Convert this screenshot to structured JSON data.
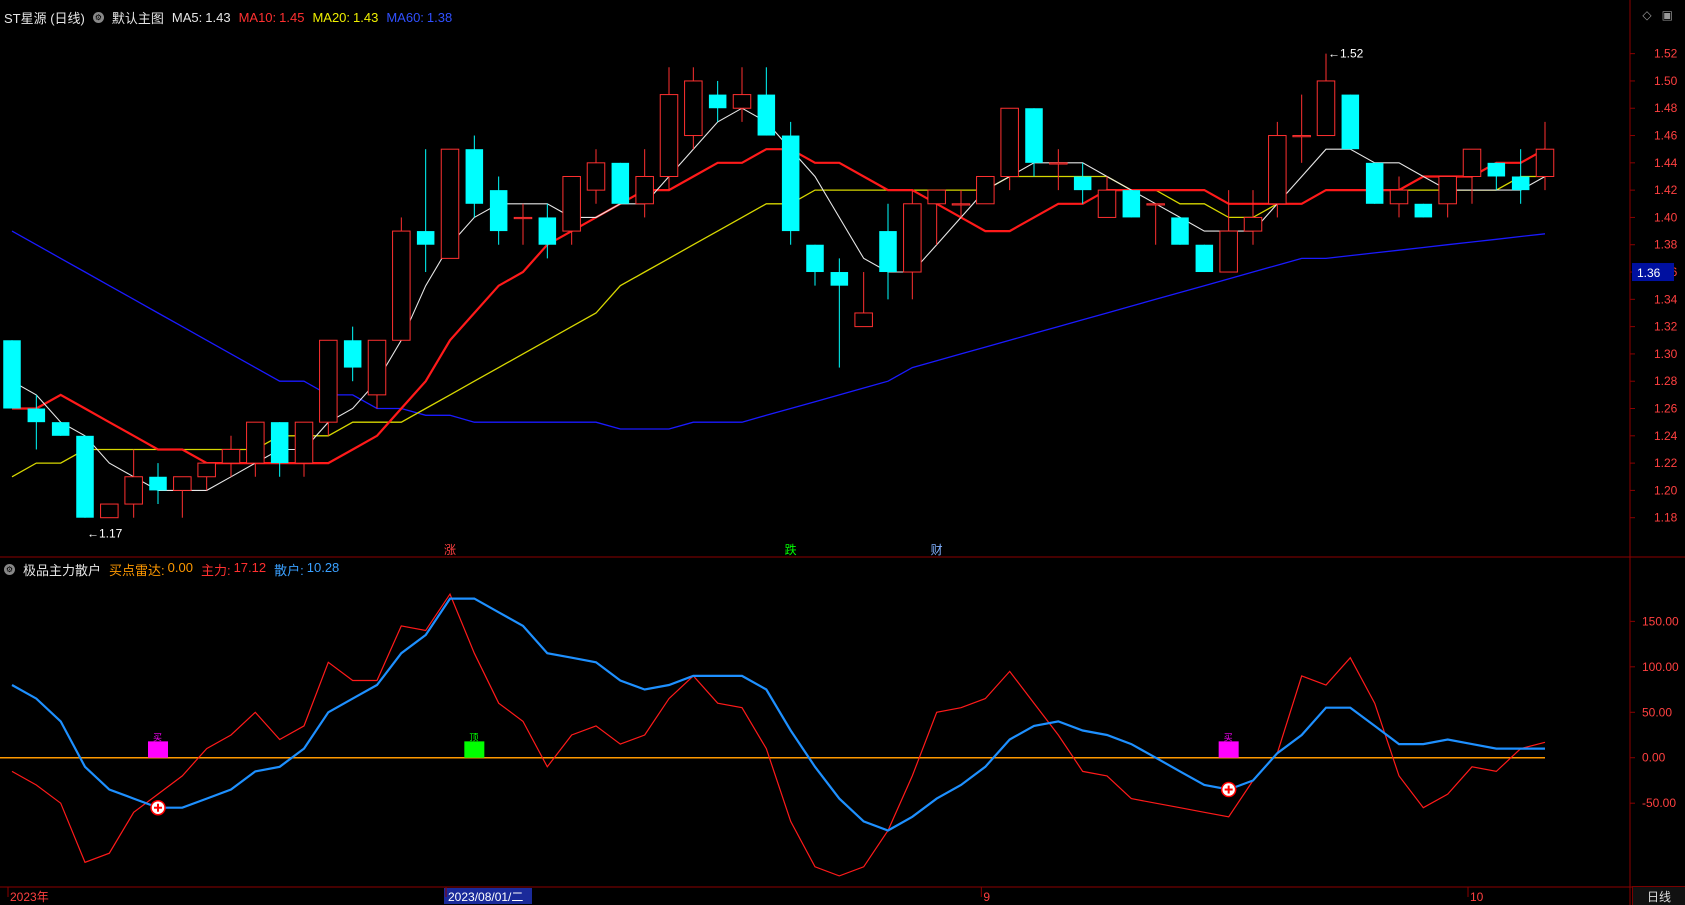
{
  "header": {
    "stock": "ST星源 (日线)",
    "main_chart": "默认主图",
    "ma5_label": "MA5:",
    "ma5_value": "1.43",
    "ma10_label": "MA10:",
    "ma10_value": "1.45",
    "ma20_label": "MA20:",
    "ma20_value": "1.43",
    "ma60_label": "MA60:",
    "ma60_value": "1.38"
  },
  "indicator": {
    "name": "极品主力散户",
    "buy_radar_label": "买点雷达:",
    "buy_radar_value": "0.00",
    "main_label": "主力:",
    "main_value": "17.12",
    "retail_label": "散户:",
    "retail_value": "10.28"
  },
  "colors": {
    "up": "#ff3030",
    "down": "#00ffff",
    "ma5": "#e6e6e6",
    "ma10": "#ff1a1a",
    "ma20": "#d7d700",
    "ma60": "#1a1aff",
    "main_line": "#ff1a1a",
    "retail_line": "#1e90ff",
    "zero_line": "#ff9900",
    "axis_border": "#8b0000"
  },
  "chart_data": [
    {
      "type": "candlestick",
      "title": "ST星源 (日线)",
      "ylim": [
        1.16,
        1.53
      ],
      "price_ticks": [
        "1.52",
        "1.50",
        "1.48",
        "1.46",
        "1.44",
        "1.42",
        "1.40",
        "1.38",
        "1.36",
        "1.34",
        "1.32",
        "1.30",
        "1.28",
        "1.26",
        "1.24",
        "1.22",
        "1.20",
        "1.18"
      ],
      "current_price_tag": "1.36",
      "high_annotation": "1.52",
      "low_annotation": "1.17",
      "ohlc": [
        [
          1.31,
          1.31,
          1.26,
          1.26
        ],
        [
          1.26,
          1.27,
          1.23,
          1.25
        ],
        [
          1.25,
          1.25,
          1.24,
          1.24
        ],
        [
          1.24,
          1.24,
          1.18,
          1.18
        ],
        [
          1.18,
          1.19,
          1.18,
          1.19
        ],
        [
          1.19,
          1.23,
          1.18,
          1.21
        ],
        [
          1.21,
          1.22,
          1.19,
          1.2
        ],
        [
          1.2,
          1.21,
          1.18,
          1.21
        ],
        [
          1.21,
          1.22,
          1.2,
          1.22
        ],
        [
          1.22,
          1.24,
          1.21,
          1.23
        ],
        [
          1.22,
          1.25,
          1.21,
          1.25
        ],
        [
          1.25,
          1.25,
          1.21,
          1.22
        ],
        [
          1.22,
          1.25,
          1.21,
          1.25
        ],
        [
          1.25,
          1.31,
          1.24,
          1.31
        ],
        [
          1.31,
          1.32,
          1.28,
          1.29
        ],
        [
          1.27,
          1.31,
          1.26,
          1.31
        ],
        [
          1.31,
          1.4,
          1.31,
          1.39
        ],
        [
          1.39,
          1.45,
          1.36,
          1.38
        ],
        [
          1.37,
          1.45,
          1.37,
          1.45
        ],
        [
          1.45,
          1.46,
          1.4,
          1.41
        ],
        [
          1.42,
          1.43,
          1.38,
          1.39
        ],
        [
          1.4,
          1.41,
          1.38,
          1.4
        ],
        [
          1.4,
          1.41,
          1.37,
          1.38
        ],
        [
          1.39,
          1.43,
          1.38,
          1.43
        ],
        [
          1.42,
          1.45,
          1.41,
          1.44
        ],
        [
          1.44,
          1.44,
          1.41,
          1.41
        ],
        [
          1.41,
          1.45,
          1.4,
          1.43
        ],
        [
          1.43,
          1.51,
          1.42,
          1.49
        ],
        [
          1.46,
          1.51,
          1.45,
          1.5
        ],
        [
          1.49,
          1.5,
          1.47,
          1.48
        ],
        [
          1.48,
          1.51,
          1.47,
          1.49
        ],
        [
          1.49,
          1.51,
          1.46,
          1.46
        ],
        [
          1.46,
          1.47,
          1.38,
          1.39
        ],
        [
          1.38,
          1.38,
          1.35,
          1.36
        ],
        [
          1.36,
          1.37,
          1.29,
          1.35
        ],
        [
          1.32,
          1.36,
          1.32,
          1.33
        ],
        [
          1.39,
          1.41,
          1.34,
          1.36
        ],
        [
          1.36,
          1.42,
          1.34,
          1.41
        ],
        [
          1.41,
          1.42,
          1.38,
          1.42
        ],
        [
          1.41,
          1.42,
          1.4,
          1.41
        ],
        [
          1.41,
          1.43,
          1.41,
          1.43
        ],
        [
          1.43,
          1.48,
          1.42,
          1.48
        ],
        [
          1.48,
          1.48,
          1.43,
          1.44
        ],
        [
          1.44,
          1.45,
          1.42,
          1.44
        ],
        [
          1.43,
          1.44,
          1.41,
          1.42
        ],
        [
          1.4,
          1.43,
          1.4,
          1.42
        ],
        [
          1.42,
          1.42,
          1.4,
          1.4
        ],
        [
          1.41,
          1.41,
          1.38,
          1.41
        ],
        [
          1.4,
          1.4,
          1.38,
          1.38
        ],
        [
          1.38,
          1.38,
          1.36,
          1.36
        ],
        [
          1.36,
          1.42,
          1.36,
          1.39
        ],
        [
          1.39,
          1.42,
          1.38,
          1.4
        ],
        [
          1.41,
          1.47,
          1.4,
          1.46
        ],
        [
          1.46,
          1.49,
          1.44,
          1.46
        ],
        [
          1.46,
          1.52,
          1.46,
          1.5
        ],
        [
          1.49,
          1.49,
          1.45,
          1.45
        ],
        [
          1.44,
          1.44,
          1.41,
          1.41
        ],
        [
          1.41,
          1.43,
          1.4,
          1.42
        ],
        [
          1.41,
          1.41,
          1.4,
          1.4
        ],
        [
          1.41,
          1.43,
          1.4,
          1.43
        ],
        [
          1.43,
          1.45,
          1.41,
          1.45
        ],
        [
          1.44,
          1.44,
          1.42,
          1.43
        ],
        [
          1.43,
          1.45,
          1.41,
          1.42
        ],
        [
          1.43,
          1.47,
          1.42,
          1.45
        ]
      ],
      "ma5": [
        1.28,
        1.27,
        1.25,
        1.24,
        1.22,
        1.21,
        1.2,
        1.2,
        1.2,
        1.21,
        1.22,
        1.23,
        1.23,
        1.25,
        1.26,
        1.28,
        1.31,
        1.35,
        1.38,
        1.4,
        1.41,
        1.41,
        1.41,
        1.4,
        1.4,
        1.41,
        1.41,
        1.43,
        1.45,
        1.47,
        1.48,
        1.47,
        1.45,
        1.43,
        1.4,
        1.37,
        1.36,
        1.36,
        1.38,
        1.4,
        1.42,
        1.43,
        1.44,
        1.44,
        1.44,
        1.43,
        1.42,
        1.41,
        1.4,
        1.39,
        1.39,
        1.39,
        1.41,
        1.43,
        1.45,
        1.45,
        1.44,
        1.44,
        1.43,
        1.42,
        1.42,
        1.42,
        1.42,
        1.43
      ],
      "ma10": [
        1.26,
        1.26,
        1.27,
        1.26,
        1.25,
        1.24,
        1.23,
        1.23,
        1.22,
        1.22,
        1.22,
        1.22,
        1.22,
        1.22,
        1.23,
        1.24,
        1.26,
        1.28,
        1.31,
        1.33,
        1.35,
        1.36,
        1.38,
        1.39,
        1.4,
        1.41,
        1.42,
        1.42,
        1.43,
        1.44,
        1.44,
        1.45,
        1.45,
        1.44,
        1.44,
        1.43,
        1.42,
        1.42,
        1.41,
        1.4,
        1.39,
        1.39,
        1.4,
        1.41,
        1.41,
        1.42,
        1.42,
        1.42,
        1.42,
        1.42,
        1.41,
        1.41,
        1.41,
        1.41,
        1.42,
        1.42,
        1.42,
        1.42,
        1.43,
        1.43,
        1.43,
        1.44,
        1.44,
        1.45
      ],
      "ma20": [
        1.21,
        1.22,
        1.22,
        1.23,
        1.23,
        1.23,
        1.23,
        1.23,
        1.23,
        1.23,
        1.23,
        1.24,
        1.24,
        1.24,
        1.25,
        1.25,
        1.25,
        1.26,
        1.27,
        1.28,
        1.29,
        1.3,
        1.31,
        1.32,
        1.33,
        1.35,
        1.36,
        1.37,
        1.38,
        1.39,
        1.4,
        1.41,
        1.41,
        1.42,
        1.42,
        1.42,
        1.42,
        1.42,
        1.42,
        1.42,
        1.42,
        1.43,
        1.43,
        1.43,
        1.43,
        1.43,
        1.42,
        1.42,
        1.41,
        1.41,
        1.4,
        1.4,
        1.41,
        1.41,
        1.42,
        1.42,
        1.42,
        1.42,
        1.42,
        1.42,
        1.42,
        1.42,
        1.43,
        1.43
      ],
      "ma60": [
        1.39,
        1.38,
        1.37,
        1.36,
        1.35,
        1.34,
        1.33,
        1.32,
        1.31,
        1.3,
        1.29,
        1.28,
        1.28,
        1.27,
        1.27,
        1.26,
        1.26,
        1.255,
        1.255,
        1.25,
        1.25,
        1.25,
        1.25,
        1.25,
        1.25,
        1.245,
        1.245,
        1.245,
        1.25,
        1.25,
        1.25,
        1.255,
        1.26,
        1.265,
        1.27,
        1.275,
        1.28,
        1.29,
        1.295,
        1.3,
        1.305,
        1.31,
        1.315,
        1.32,
        1.325,
        1.33,
        1.335,
        1.34,
        1.345,
        1.35,
        1.355,
        1.36,
        1.365,
        1.37,
        1.37,
        1.372,
        1.374,
        1.376,
        1.378,
        1.38,
        1.382,
        1.384,
        1.386,
        1.388
      ]
    },
    {
      "type": "line",
      "title": "极品主力散户",
      "ylim": [
        -140,
        190
      ],
      "y_ticks": [
        "150.00",
        "100.00",
        "50.00",
        "0.00",
        "-50.00"
      ],
      "series": [
        {
          "name": "主力",
          "values": [
            -15,
            -30,
            -50,
            -115,
            -105,
            -60,
            -40,
            -20,
            10,
            25,
            50,
            20,
            35,
            105,
            85,
            85,
            145,
            140,
            180,
            115,
            60,
            40,
            -10,
            25,
            35,
            15,
            25,
            65,
            90,
            60,
            55,
            10,
            -70,
            -120,
            -130,
            -120,
            -80,
            -20,
            50,
            55,
            65,
            95,
            60,
            25,
            -15,
            -20,
            -45,
            -50,
            -55,
            -60,
            -65,
            -25,
            5,
            90,
            80,
            110,
            60,
            -20,
            -55,
            -40,
            -10,
            -15,
            10,
            17
          ]
        },
        {
          "name": "散户",
          "values": [
            80,
            65,
            40,
            -10,
            -35,
            -45,
            -55,
            -55,
            -45,
            -35,
            -15,
            -10,
            10,
            50,
            65,
            80,
            115,
            135,
            175,
            175,
            160,
            145,
            115,
            110,
            105,
            85,
            75,
            80,
            90,
            90,
            90,
            75,
            30,
            -10,
            -45,
            -70,
            -80,
            -65,
            -45,
            -30,
            -10,
            20,
            35,
            40,
            30,
            25,
            15,
            0,
            -15,
            -30,
            -35,
            -25,
            5,
            25,
            55,
            55,
            35,
            15,
            15,
            20,
            15,
            10,
            10,
            10
          ]
        }
      ],
      "buy_markers": [
        6,
        50
      ],
      "signal_bars": [
        {
          "index": 6,
          "label": "买",
          "color": "#ff00ff"
        },
        {
          "index": 19,
          "label": "顶",
          "color": "#00ff00"
        },
        {
          "index": 50,
          "label": "买",
          "color": "#ff00ff"
        }
      ]
    }
  ],
  "event_markers": [
    {
      "index": 18,
      "label": "涨",
      "color": "#ff4040"
    },
    {
      "index": 32,
      "label": "跌",
      "color": "#00ff00"
    },
    {
      "index": 38,
      "label": "财",
      "color": "#80b0ff"
    }
  ],
  "time_axis": {
    "labels": [
      {
        "index": 0,
        "text": "2023年"
      },
      {
        "index": 18,
        "text": "2023/08/01/二",
        "highlight": true
      },
      {
        "index": 40,
        "text": "9"
      },
      {
        "index": 60,
        "text": "10"
      }
    ],
    "period": "日线"
  }
}
